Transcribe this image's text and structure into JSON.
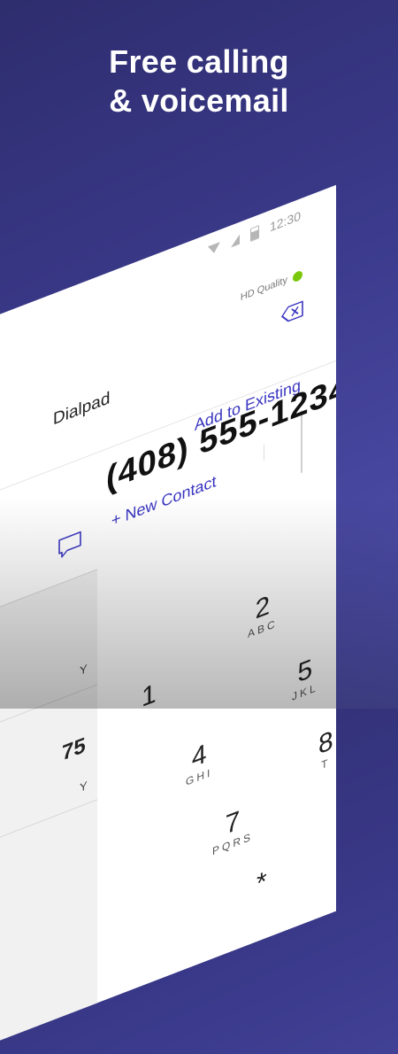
{
  "promo": {
    "line1": "Free calling",
    "line2": "& voicemail"
  },
  "status_bar": {
    "time": "12:30"
  },
  "dialer": {
    "quality_label": "HD Quality",
    "quality_color": "#7ac70c",
    "app_title": "Dialpad",
    "phone_number": "(408) 555-1234",
    "new_contact_label": "+ New Contact",
    "add_existing_label": "Add to Existing",
    "accent_color": "#3a36c0"
  },
  "left_panel": {
    "fragment_1": "Y",
    "fragment_2": "Y",
    "fragment_3": "75"
  },
  "keypad": [
    {
      "digit": "1",
      "letters": ""
    },
    {
      "digit": "2",
      "letters": "ABC"
    },
    {
      "digit": "4",
      "letters": "GHI"
    },
    {
      "digit": "5",
      "letters": "JKL"
    },
    {
      "digit": "7",
      "letters": "PQRS"
    },
    {
      "digit": "8",
      "letters": "T"
    },
    {
      "digit": "*",
      "letters": ""
    }
  ],
  "icons": {
    "backspace": "backspace-icon",
    "message": "chat-bubble-icon",
    "wifi": "wifi-icon",
    "signal": "signal-icon",
    "battery": "battery-icon"
  }
}
